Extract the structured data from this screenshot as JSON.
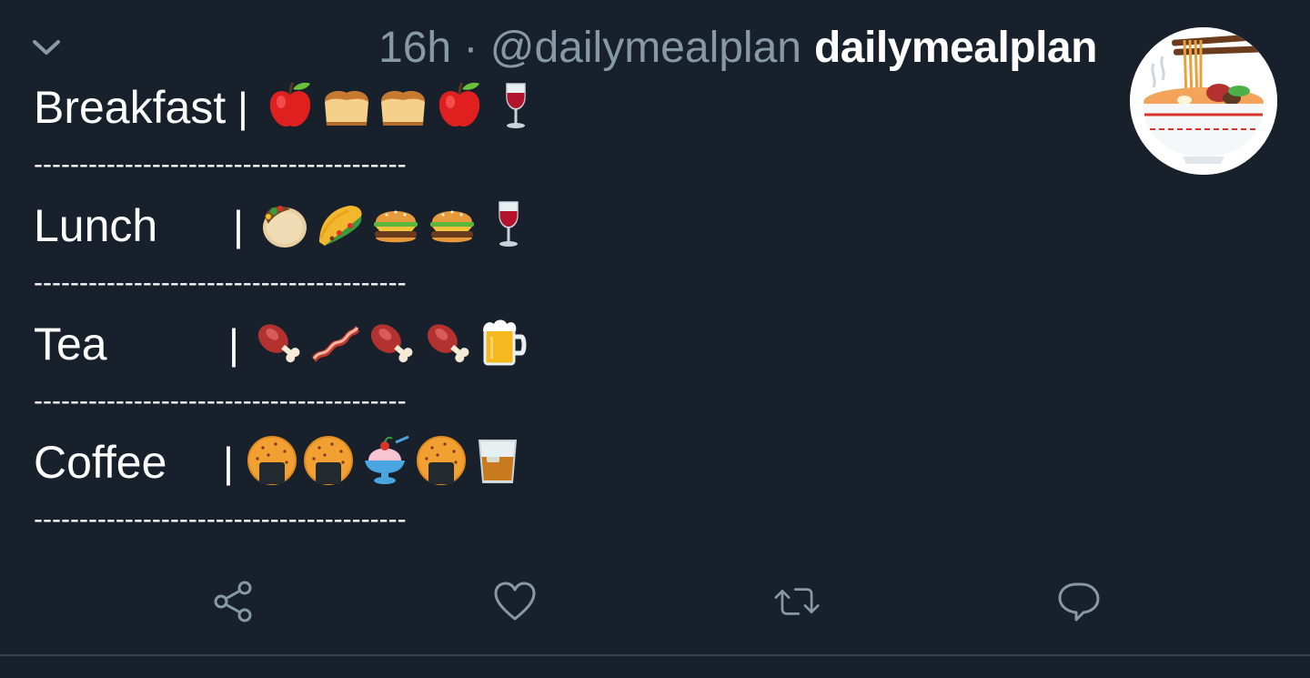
{
  "header": {
    "meta": "16h · @dailymealplan",
    "display_name": "dailymealplan"
  },
  "meals": [
    {
      "label": "Breakfast",
      "pipe": "|",
      "emojis": [
        "apple-icon",
        "bread-icon",
        "bread-icon",
        "apple-icon",
        "wine-glass-icon"
      ]
    },
    {
      "label": "Lunch",
      "pipe": "|",
      "emojis": [
        "stuffed-flatbread-icon",
        "taco-icon",
        "hamburger-icon",
        "hamburger-icon",
        "wine-glass-icon"
      ]
    },
    {
      "label": "Tea",
      "pipe": "|",
      "emojis": [
        "meat-on-bone-icon",
        "bacon-icon",
        "meat-on-bone-icon",
        "meat-on-bone-icon",
        "beer-mug-icon"
      ]
    },
    {
      "label": "Coffee",
      "pipe": "|",
      "emojis": [
        "rice-cracker-icon",
        "rice-cracker-icon",
        "shaved-ice-icon",
        "rice-cracker-icon",
        "tumbler-glass-icon"
      ]
    }
  ],
  "separator": "-----------------------------------------",
  "actions": [
    "share-icon",
    "like-heart-icon",
    "retweet-icon",
    "reply-icon"
  ],
  "colors": {
    "background": "#17202b",
    "meta_text": "#8899a6",
    "action_icon": "#8899a6",
    "rule": "#38444d"
  }
}
